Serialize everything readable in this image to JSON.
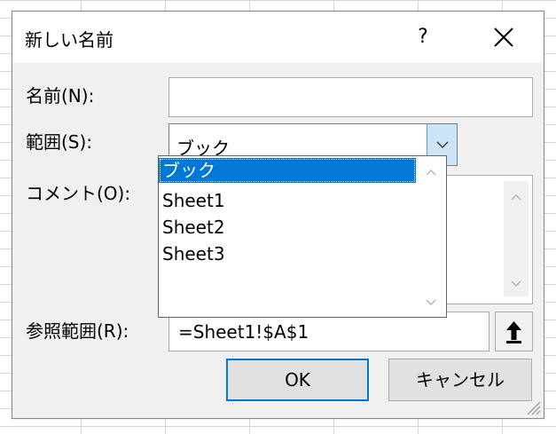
{
  "dialog": {
    "title": "新しい名前",
    "help_label": "?",
    "close_icon": "close-icon"
  },
  "fields": {
    "name_label": "名前(N):",
    "name_value": "",
    "scope_label": "範囲(S):",
    "scope_value": "ブック",
    "comment_label": "コメント(O):",
    "comment_value": "",
    "refers_label": "参照範囲(R):",
    "refers_value": "=Sheet1!$A$1"
  },
  "scope_options": [
    "ブック",
    "Sheet1",
    "Sheet2",
    "Sheet3"
  ],
  "scope_selected_index": 0,
  "buttons": {
    "ok": "OK",
    "cancel": "キャンセル"
  },
  "colors": {
    "accent": "#0078d7",
    "arrow_bg": "#cce4f7"
  }
}
